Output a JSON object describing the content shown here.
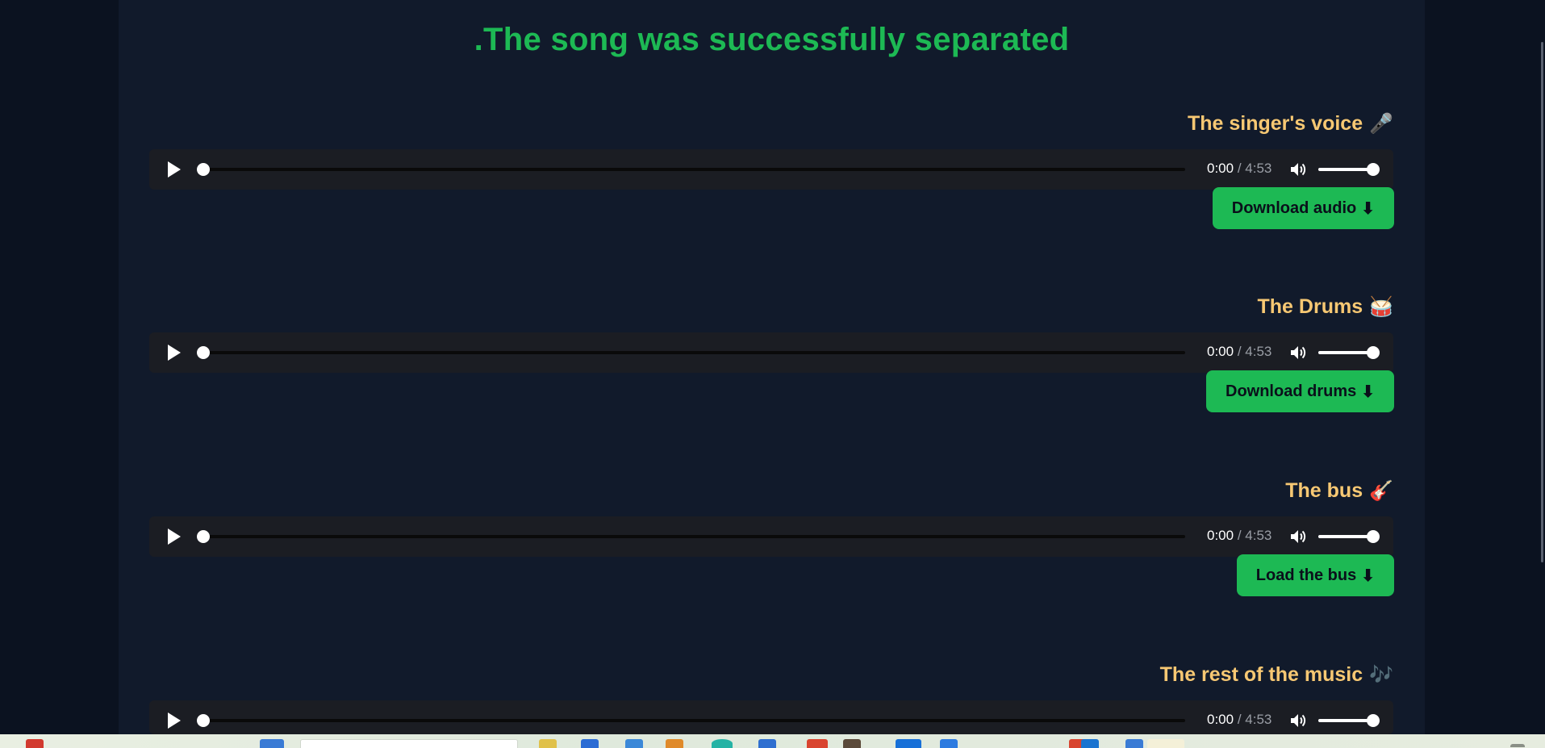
{
  "page": {
    "title": ".The song was successfully separated"
  },
  "tracks": [
    {
      "heading": "The singer's voice",
      "emoji": "🎤",
      "emoji_name": "microphone-icon",
      "player": {
        "current_time": "0:00",
        "separator": " / ",
        "duration": "4:53",
        "progress": 0,
        "volume": 1
      },
      "button_label": "Download audio",
      "button_icon": "⬇"
    },
    {
      "heading": "The Drums",
      "emoji": "🥁",
      "emoji_name": "drum-icon",
      "player": {
        "current_time": "0:00",
        "separator": " / ",
        "duration": "4:53",
        "progress": 0,
        "volume": 1
      },
      "button_label": "Download drums",
      "button_icon": "⬇"
    },
    {
      "heading": "The bus",
      "emoji": "🎸",
      "emoji_name": "guitar-icon",
      "player": {
        "current_time": "0:00",
        "separator": " / ",
        "duration": "4:53",
        "progress": 0,
        "volume": 1
      },
      "button_label": "Load the bus",
      "button_icon": "⬇"
    },
    {
      "heading": "The rest of the music",
      "emoji": "🎶",
      "emoji_name": "music-notes-icon",
      "player": {
        "current_time": "0:00",
        "separator": " / ",
        "duration": "4:53",
        "progress": 0,
        "volume": 1
      }
    }
  ],
  "colors": {
    "background": "#0b1220",
    "panel": "#111a2b",
    "accent_green": "#1db954",
    "heading_gold": "#f7c873",
    "player_bg": "#1b1d23"
  }
}
